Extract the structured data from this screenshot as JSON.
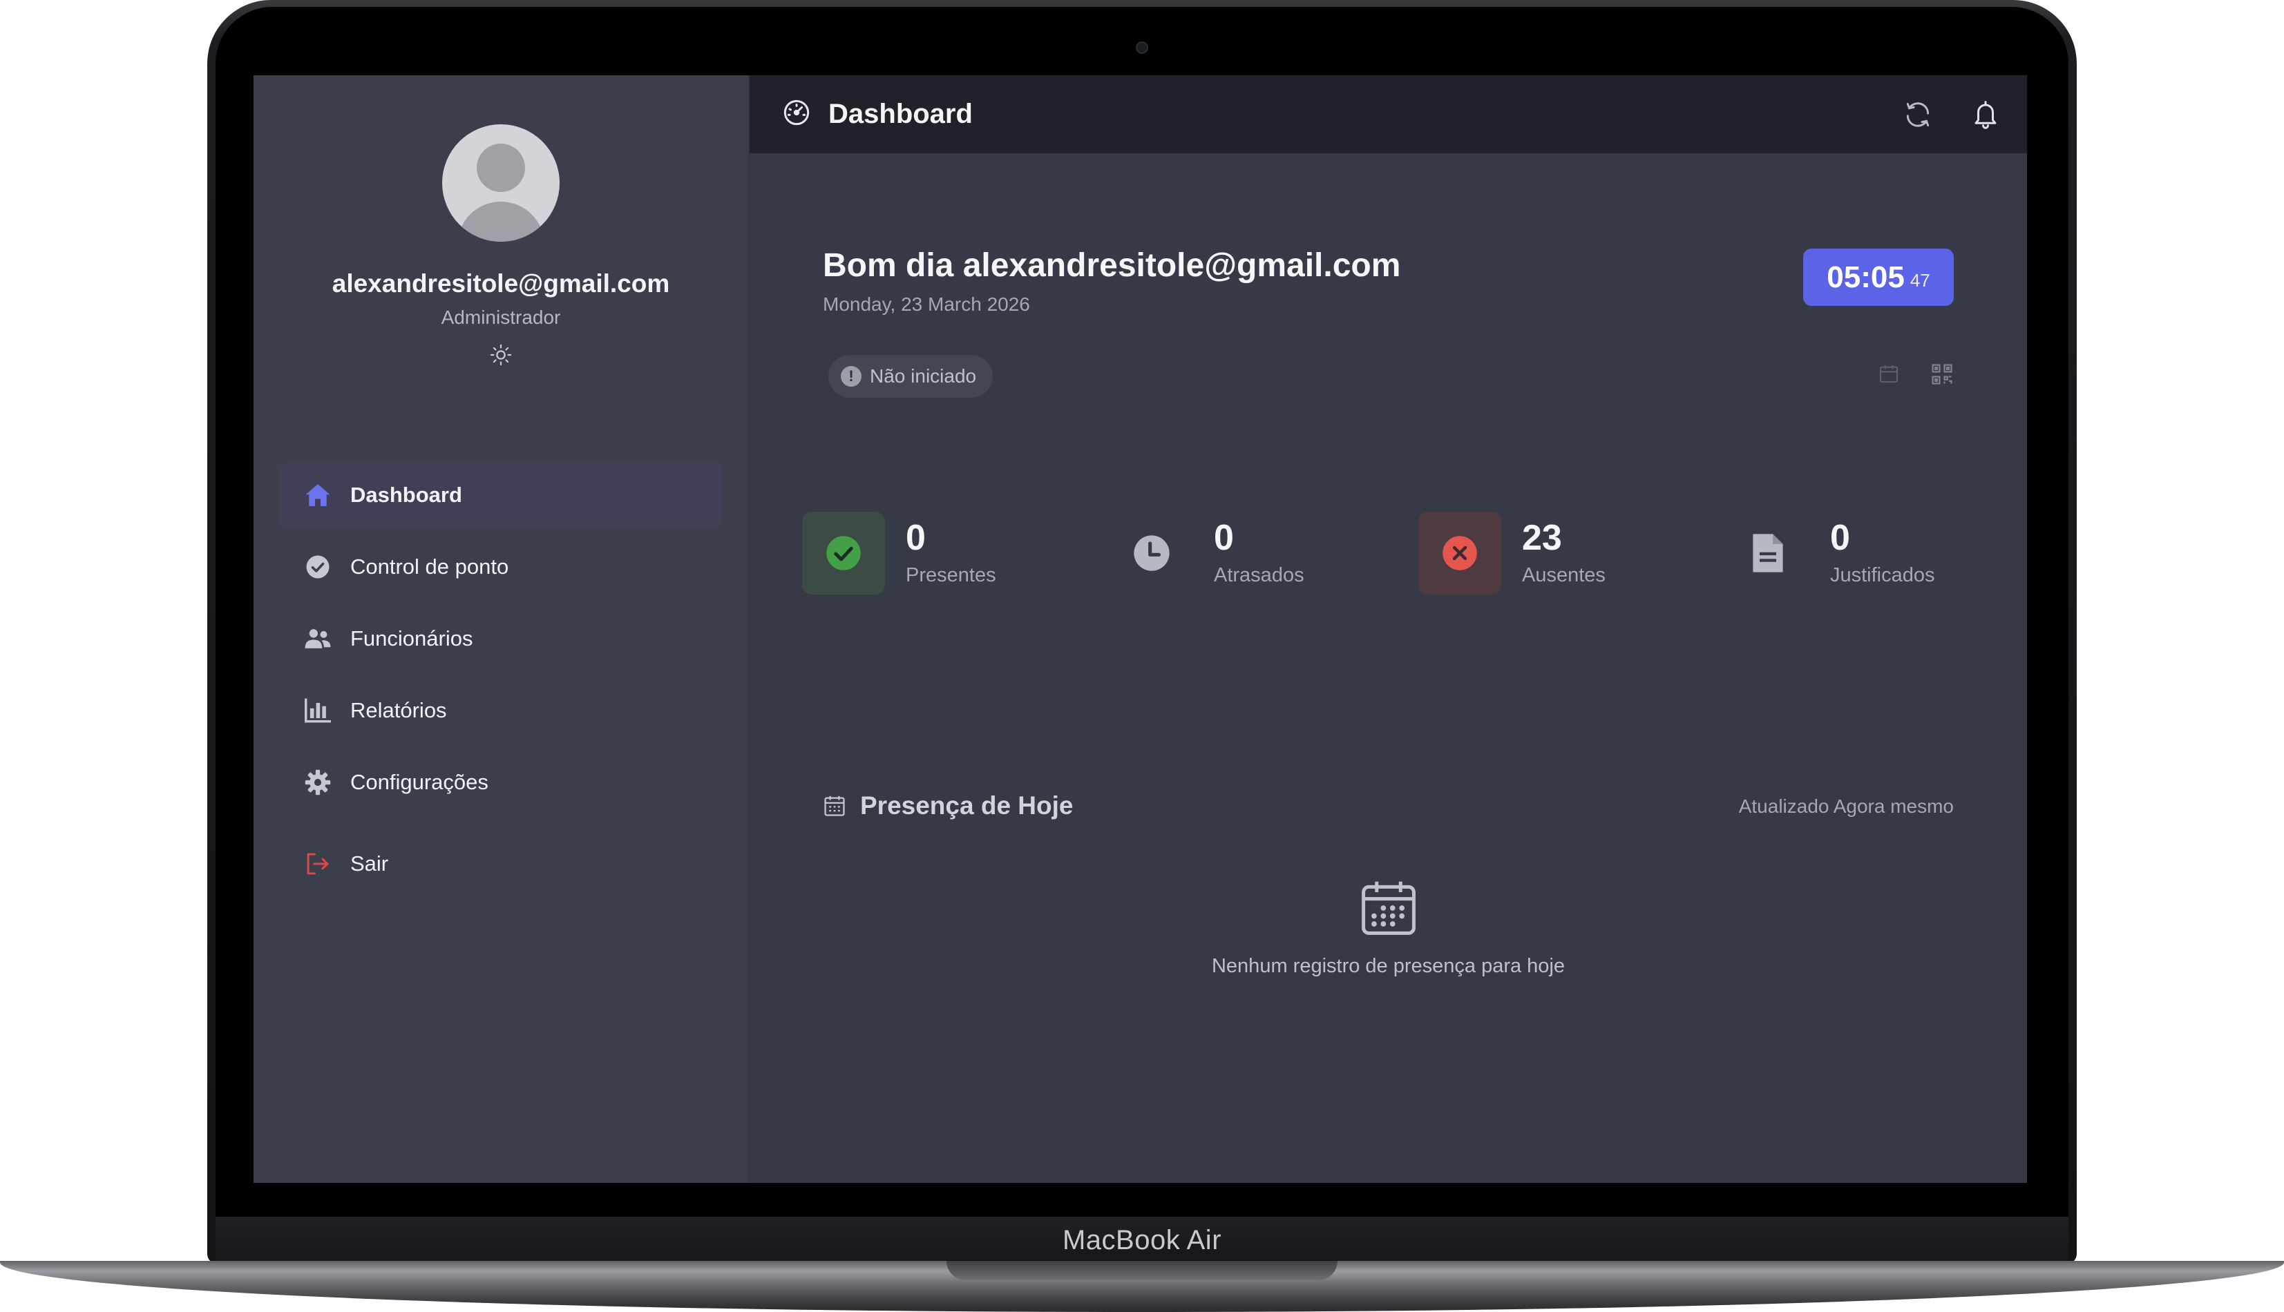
{
  "device": {
    "label": "MacBook Air"
  },
  "sidebar": {
    "user": {
      "email": "alexandresitole@gmail.com",
      "role": "Administrador"
    },
    "items": [
      {
        "label": "Dashboard",
        "icon": "home-icon",
        "active": true
      },
      {
        "label": "Control de ponto",
        "icon": "check-circle-icon",
        "active": false
      },
      {
        "label": "Funcionários",
        "icon": "users-icon",
        "active": false
      },
      {
        "label": "Relatórios",
        "icon": "bar-chart-icon",
        "active": false
      },
      {
        "label": "Configurações",
        "icon": "gear-icon",
        "active": false
      },
      {
        "label": "Sair",
        "icon": "logout-icon",
        "active": false
      }
    ]
  },
  "header": {
    "title": "Dashboard",
    "icon": "speedometer-icon",
    "actions": [
      "refresh-icon",
      "bell-icon"
    ]
  },
  "main": {
    "greeting": "Bom dia alexandresitole@gmail.com",
    "date": "Monday, 23 March 2026",
    "clock": {
      "hm": "05:05",
      "s": "47"
    },
    "status": {
      "icon": "!",
      "label": "Não iniciado"
    },
    "tools": [
      "calendar-icon",
      "qr-code-icon"
    ],
    "stats": [
      {
        "value": "0",
        "label": "Presentes",
        "icon": "check-icon",
        "color": "#43a047"
      },
      {
        "value": "0",
        "label": "Atrasados",
        "icon": "clock-icon",
        "color": "#b6b8c2"
      },
      {
        "value": "23",
        "label": "Ausentes",
        "icon": "x-icon",
        "color": "#e5564f"
      },
      {
        "value": "0",
        "label": "Justificados",
        "icon": "document-icon",
        "color": "#b6b8c2"
      }
    ],
    "attendance": {
      "title": "Presença de Hoje",
      "updated": "Atualizado Agora mesmo",
      "empty_text": "Nenhum registro de presença para hoje"
    }
  },
  "colors": {
    "accent": "#5b63e6",
    "success": "#43a047",
    "danger": "#e5564f",
    "sidebar_bg": "#3b3e4b",
    "topbar_bg": "#202129"
  }
}
